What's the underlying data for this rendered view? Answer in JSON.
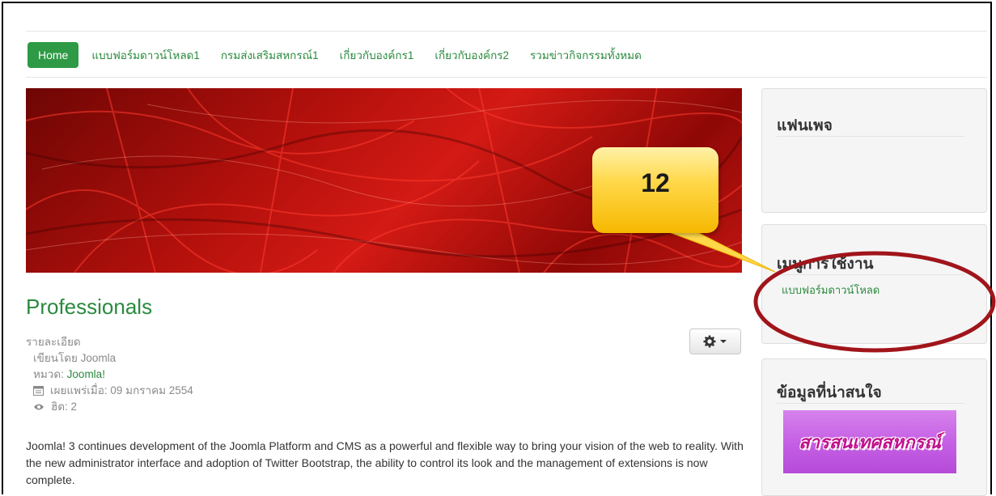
{
  "nav": {
    "items": [
      {
        "label": "Home",
        "active": true
      },
      {
        "label": "แบบฟอร์มดาวน์โหลด1",
        "active": false
      },
      {
        "label": "กรมส่งเสริมสหกรณ์1",
        "active": false
      },
      {
        "label": "เกี่ยวกับองค์กร1",
        "active": false
      },
      {
        "label": "เกี่ยวกับองค์กร2",
        "active": false
      },
      {
        "label": "รวมข่าวกิจกรรมทั้งหมด",
        "active": false
      }
    ]
  },
  "article": {
    "title": "Professionals",
    "details_label": "รายละเอียด",
    "author": "เขียนโดย Joomla",
    "category_label": "หมวด:",
    "category": "Joomla!",
    "published": "เผยแพร่เมื่อ: 09 มกราคม 2554",
    "hits": "ฮิต: 2",
    "body": "Joomla! 3 continues development of the Joomla Platform and CMS as a powerful and flexible way to bring your vision of the web to reality. With the new administrator interface and adoption of Twitter Bootstrap, the ability to control its look and the management of extensions is now complete."
  },
  "sidebar": {
    "fanpage_title": "แฟนเพจ",
    "menu_title": "เมนูการใช้งาน",
    "menu_items": [
      "แบบฟอร์มดาวน์โหลด"
    ],
    "info_title": "ข้อมูลที่น่าสนใจ",
    "banner_text": "สารสนเทศสหกรณ์"
  },
  "annotation": {
    "step_number": "12",
    "callout_color": "#ffd84a",
    "circle_color": "#a0151b"
  },
  "colors": {
    "accent_green": "#2a8a3e",
    "home_button": "#2e9a45"
  },
  "icons": {
    "tools": "gear-icon",
    "caret": "caret-down-icon",
    "published": "calendar-icon",
    "hits": "eye-icon"
  }
}
